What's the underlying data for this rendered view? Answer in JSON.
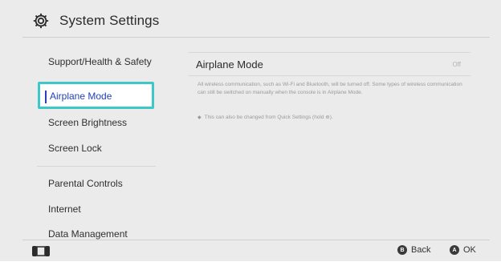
{
  "header": {
    "title": "System Settings",
    "icon": "gear-icon"
  },
  "sidebar": {
    "items": [
      {
        "label": "Support/Health & Safety"
      },
      {
        "label": "Airplane Mode",
        "selected": true
      },
      {
        "label": "Screen Brightness"
      },
      {
        "label": "Screen Lock"
      },
      {
        "label": "Parental Controls"
      },
      {
        "label": "Internet"
      },
      {
        "label": "Data Management"
      }
    ]
  },
  "main": {
    "setting_label": "Airplane Mode",
    "setting_value": "Off",
    "description": "All wireless communication, such as Wi-Fi and Bluetooth, will be turned off. Some types of wireless communication can still be switched on manually when the console is in Airplane Mode.",
    "note": "This can also be changed from Quick Settings (hold ⊕)."
  },
  "footer": {
    "back_glyph": "B",
    "back_label": "Back",
    "ok_glyph": "A",
    "ok_label": "OK"
  },
  "colors": {
    "selection_border": "#3ec7c9",
    "selection_text": "#2440b8",
    "background": "#ebebeb"
  }
}
